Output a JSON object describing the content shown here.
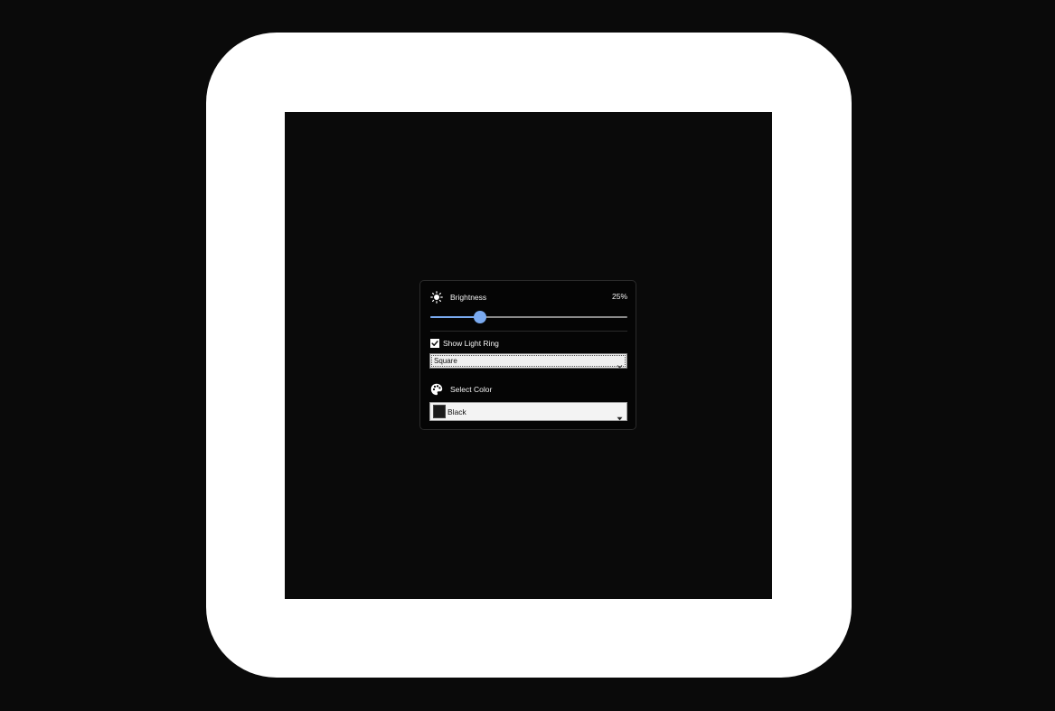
{
  "brightness": {
    "label": "Brightness",
    "value_text": "25%",
    "level_percent": 25,
    "icon": "sun-icon"
  },
  "light_ring": {
    "checkbox_label": "Show Light Ring",
    "checked": true,
    "shape_selected": "Square",
    "color": "#ffffff"
  },
  "color_picker": {
    "label": "Select Color",
    "icon": "palette-icon",
    "selected": "Black",
    "swatch_color": "#1a1a1a"
  },
  "colors": {
    "accent": "#7aaaf0",
    "background": "#0a0a0a"
  }
}
